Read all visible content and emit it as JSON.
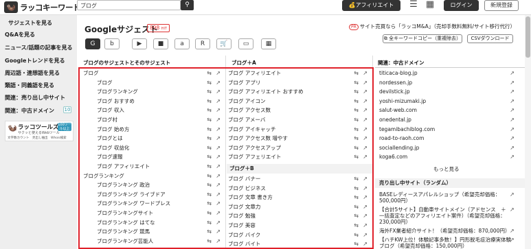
{
  "header": {
    "logo_text": "ラッコキーワード",
    "search_value": "ブログ",
    "affiliate_label": "アフィリエイト",
    "login_label": "ログイン",
    "signup_label": "新規登録"
  },
  "sidebar": {
    "items": [
      {
        "label": "サジェストを見る"
      },
      {
        "label": "Q&Aを見る"
      },
      {
        "label": "ニュース/話題の記事を見る"
      },
      {
        "label": "Googleトレンドを見る"
      },
      {
        "label": "周辺語・連想語を見る"
      },
      {
        "label": "類語・同義語を見る"
      },
      {
        "label": "関連：売り出し中サイト"
      },
      {
        "label": "関連：中古ドメイン"
      }
    ],
    "badge": "10",
    "banner": {
      "title": "ラッコツールズ",
      "subtitle": "サクッと使えるWebツール",
      "tag": "100ツール以上 無料!",
      "chips": "文字数カウント　見出し抽出　Whois検索"
    }
  },
  "main": {
    "title": "Googleサジェスト",
    "count": "898",
    "count_unit": "HIT",
    "pr_label": "PR",
    "pr_text": "サイト売買なら「ラッコM&A」（売却手数料無料/サイト移行代行）",
    "copy_all_label": "全キーワードコピー（重複除去）",
    "csv_label": "CSVダウンロード",
    "engines": [
      "G",
      "b",
      "▶",
      "■",
      "a",
      "R",
      "🛒",
      "▭",
      "▦"
    ]
  },
  "col1": {
    "header": "ブログのサジェストとそのサジェスト",
    "rows": [
      {
        "text": "ブログ",
        "indent": 0
      },
      {
        "text": "ブログ",
        "indent": 1
      },
      {
        "text": "ブログランキング",
        "indent": 1
      },
      {
        "text": "ブログ おすすめ",
        "indent": 1
      },
      {
        "text": "ブログ 収入",
        "indent": 1
      },
      {
        "text": "ブログ村",
        "indent": 1
      },
      {
        "text": "ブログ 始め方",
        "indent": 1
      },
      {
        "text": "ブログとは",
        "indent": 1
      },
      {
        "text": "ブログ 収益化",
        "indent": 1
      },
      {
        "text": "ブログ速報",
        "indent": 1
      },
      {
        "text": "ブログ アフィリエイト",
        "indent": 1
      },
      {
        "text": "ブログランキング",
        "indent": 0
      },
      {
        "text": "ブログランキング 政治",
        "indent": 1
      },
      {
        "text": "ブログランキング ライブドア",
        "indent": 1
      },
      {
        "text": "ブログランキング ワードプレス",
        "indent": 1
      },
      {
        "text": "ブログランキングサイト",
        "indent": 1
      },
      {
        "text": "ブログランキング はてな",
        "indent": 1
      },
      {
        "text": "ブログランキング 競馬",
        "indent": 1
      },
      {
        "text": "ブログランキング芸能人",
        "indent": 1
      }
    ]
  },
  "col2": {
    "header": "ブログ＋A",
    "rows_a": [
      "ブログ アフィリエイト",
      "ブログ アプリ",
      "ブログ アフィリエイト おすすめ",
      "ブログ アイコン",
      "ブログ アクセス数",
      "ブログ アメーバ",
      "ブログ アイキャッチ",
      "ブログ アクセス数 増やす",
      "ブログ アクセスアップ",
      "ブログ アフェリエイト"
    ],
    "header_b": "ブログ＋B",
    "rows_b": [
      "ブログ バナー",
      "ブログ ビジネス",
      "ブログ 文章 書き方",
      "ブログ 文章力",
      "ブログ 勉強",
      "ブログ 美容",
      "ブログ バイク",
      "ブログ バイト"
    ]
  },
  "col3": {
    "header": "関連：中古ドメイン",
    "domains": [
      "titicaca-blog.jp",
      "nordessen.jp",
      "devilstick.jp",
      "yoshi-mizumaki.jp",
      "salut-web.com",
      "onedental.jp",
      "tegamibachiblog.com",
      "road-to-raoh.com",
      "sociallending.jp",
      "koga6.com"
    ],
    "more_label": "もっと見る",
    "sell_header": "売り出し中サイト（ランダム）",
    "sell_items": [
      "BASEレディースアパレルショップ（希望売却価格：500,000円）",
      "【合計5サイト】自動車サイトメイン（アドセンス　＋　一括査定などのアフィリエイト案件）（希望売却価格：230,000円）",
      "海外FX業者紹介サイト！（希望売却価格：870,000円）",
      "【ハチKW上位！体験記事多数！】円形脱毛症治療実体験ブログ（希望売却価格：150,000円）"
    ]
  }
}
